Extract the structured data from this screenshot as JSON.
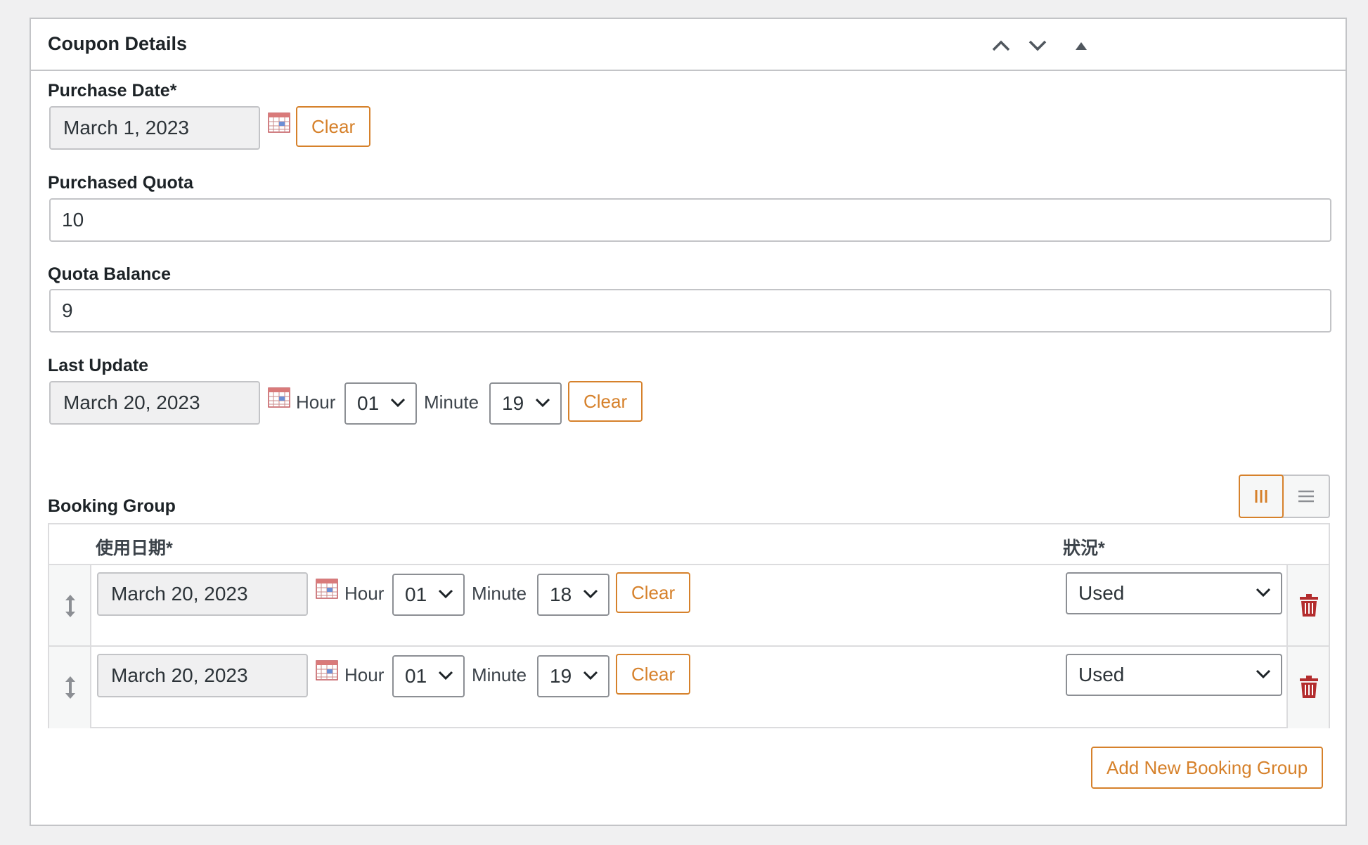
{
  "panel": {
    "title": "Coupon Details"
  },
  "purchase_date": {
    "label": "Purchase Date*",
    "value": "March 1, 2023",
    "clear_label": "Clear"
  },
  "purchased_quota": {
    "label": "Purchased Quota",
    "value": "10"
  },
  "quota_balance": {
    "label": "Quota Balance",
    "value": "9"
  },
  "last_update": {
    "label": "Last Update",
    "date": "March 20, 2023",
    "hour_label": "Hour",
    "hour": "01",
    "minute_label": "Minute",
    "minute": "19",
    "clear_label": "Clear"
  },
  "booking_group": {
    "label": "Booking Group",
    "columns": [
      "使用日期*",
      "狀況*"
    ],
    "rows": [
      {
        "date": "March 20, 2023",
        "hour_label": "Hour",
        "hour": "01",
        "minute_label": "Minute",
        "minute": "18",
        "clear_label": "Clear",
        "status": "Used"
      },
      {
        "date": "March 20, 2023",
        "hour_label": "Hour",
        "hour": "01",
        "minute_label": "Minute",
        "minute": "19",
        "clear_label": "Clear",
        "status": "Used"
      }
    ],
    "add_label": "Add New Booking Group"
  },
  "colors": {
    "accent": "#d6812b",
    "delete": "#b32d2e"
  },
  "icons": [
    "chevron-up-icon",
    "chevron-down-icon",
    "triangle-up-icon",
    "calendar-icon",
    "columns-icon",
    "rows-icon",
    "drag-handle-icon",
    "trash-icon"
  ]
}
